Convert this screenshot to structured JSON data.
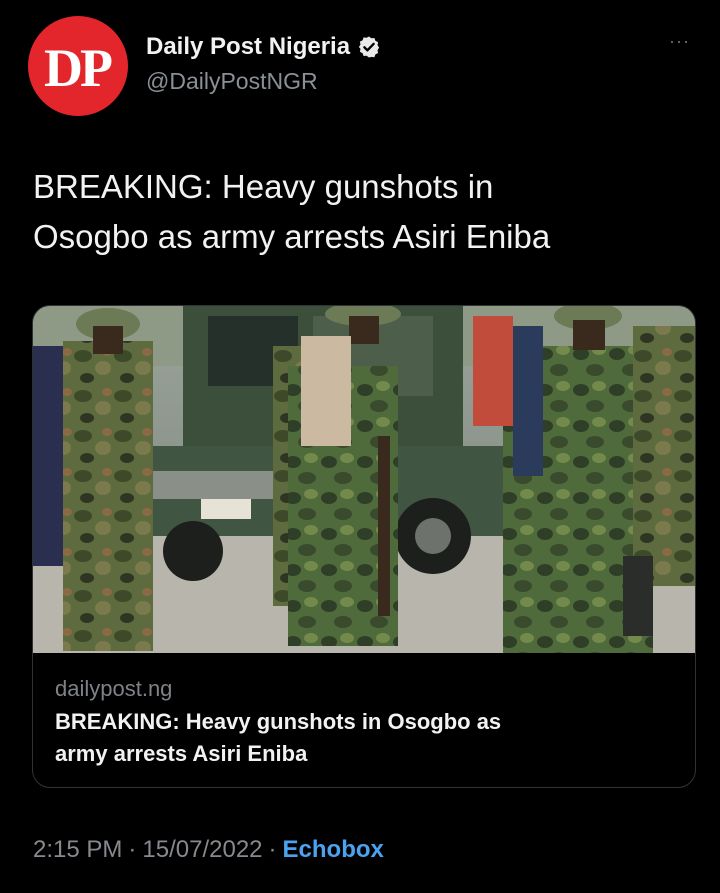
{
  "author": {
    "avatar_text": "DP",
    "display_name": "Daily Post Nigeria",
    "handle": "@DailyPostNGR",
    "verified": true,
    "avatar_color": "#e3262b"
  },
  "more_label": "···",
  "tweet": {
    "text_line1": "BREAKING: Heavy gunshots in",
    "text_line2": "Osogbo as army arrests Asiri Eniba"
  },
  "card": {
    "image_description_icon": "photo",
    "domain": "dailypost.ng",
    "title_line1": "BREAKING: Heavy gunshots in Osogbo as",
    "title_line2": "army arrests Asiri Eniba"
  },
  "meta": {
    "time": "2:15 PM",
    "separator": "·",
    "date": "15/07/2022",
    "source": "Echobox"
  },
  "colors": {
    "background": "#000000",
    "link": "#4aa3f0",
    "secondary_text": "#868a8f"
  }
}
